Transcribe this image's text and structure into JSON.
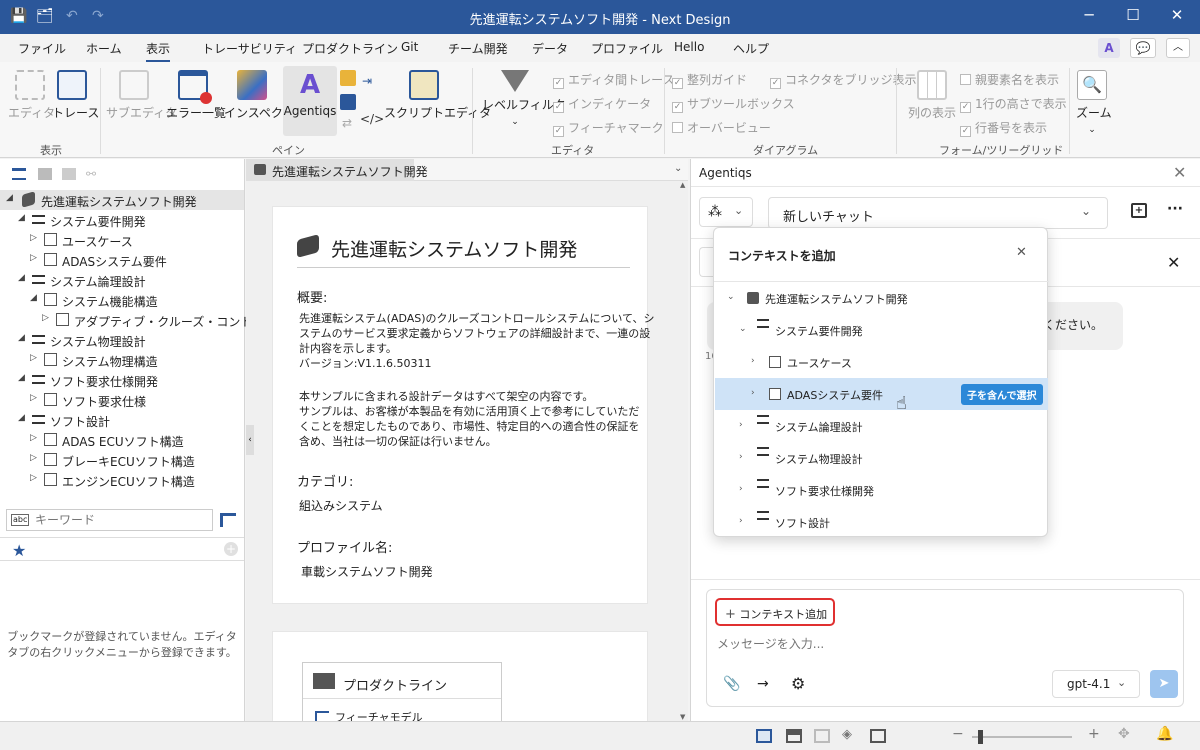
{
  "window": {
    "title": "先進運転システムソフト開発 - Next Design"
  },
  "menu": [
    "ファイル",
    "ホーム",
    "表示",
    "トレーサビリティ",
    "プロダクトライン",
    "Git",
    "チーム開発",
    "データ",
    "プロファイル",
    "Hello",
    "ヘルプ"
  ],
  "menu_active": "表示",
  "ribbon": {
    "btn_editor": "エディタ",
    "btn_trace": "トレース",
    "group_display": "表示",
    "btn_subeditor": "サブエディタ",
    "btn_errorlist": "エラー一覧",
    "btn_inspector": "インスペクタ",
    "btn_agentiqs": "Agentiqs",
    "btn_scripteditor": "スクリプトエディタ",
    "group_pane": "ペイン",
    "btn_levelfilter": "レベルフィルタ",
    "chk_editor_trace": "エディタ間トレース",
    "chk_indicator": "インディケータ",
    "chk_feature_mark": "フィーチャマーク",
    "group_editor": "エディタ",
    "chk_align_guide": "整列ガイド",
    "chk_subtoolbox": "サブツールボックス",
    "chk_overview": "オーバービュー",
    "chk_connector_bridge": "コネクタをブリッジ表示",
    "group_diagram": "ダイアグラム",
    "btn_column_display": "列の表示",
    "chk_parent_name": "親要素名を表示",
    "chk_one_line": "1行の高さで表示",
    "chk_row_number": "行番号を表示",
    "group_form": "フォーム/ツリーグリッド",
    "btn_zoom": "ズーム"
  },
  "tree": {
    "root": "先進運転システムソフト開発",
    "items": [
      {
        "label": "システム要件開発",
        "level": 1
      },
      {
        "label": "ユースケース",
        "level": 2
      },
      {
        "label": "ADASシステム要件",
        "level": 2
      },
      {
        "label": "システム論理設計",
        "level": 1
      },
      {
        "label": "システム機能構造",
        "level": 2
      },
      {
        "label": "アダプティブ・クルーズ・コントロール",
        "level": 3
      },
      {
        "label": "システム物理設計",
        "level": 1
      },
      {
        "label": "システム物理構造",
        "level": 2
      },
      {
        "label": "ソフト要求仕様開発",
        "level": 1
      },
      {
        "label": "ソフト要求仕様",
        "level": 2
      },
      {
        "label": "ソフト設計",
        "level": 1
      },
      {
        "label": "ADAS ECUソフト構造",
        "level": 2
      },
      {
        "label": "ブレーキECUソフト構造",
        "level": 2
      },
      {
        "label": "エンジンECUソフト構造",
        "level": 2
      }
    ]
  },
  "search": {
    "placeholder": "キーワード"
  },
  "bookmark": {
    "empty_text_1": "ブックマークが登録されていません。エディタ",
    "empty_text_2": "タブの右クリックメニューから登録できます。"
  },
  "doc": {
    "tab": "先進運転システムソフト開発",
    "title": "先進運転システムソフト開発",
    "overview_heading": "概要:",
    "overview_lines": [
      "先進運転システム(ADAS)のクルーズコントロールシステムについて、シ",
      "ステムのサービス要求定義からソフトウェアの詳細設計まで、一連の設",
      "計内容を示します。",
      "バージョン:V1.1.6.50311"
    ],
    "notice_lines": [
      "本サンプルに含まれる設計データはすべて架空の内容です。",
      "サンプルは、お客様が本製品を有効に活用頂く上で参考にしていただ",
      "くことを想定したものであり、市場性、特定目的への適合性の保証を",
      "含め、当社は一切の保証は行いません。"
    ],
    "category_heading": "カテゴリ:",
    "category_value": "組込みシステム",
    "profile_heading": "プロファイル名:",
    "profile_value": "車載システムソフト開発",
    "productline_title": "プロダクトライン",
    "feature_model": "フィーチャモデル"
  },
  "agent": {
    "panel_title": "Agentiqs",
    "chat_select": "新しいチャット",
    "bubble_tail": "ください。",
    "timestamp_fragment": "16",
    "popup_title": "コンテキストを追加",
    "popup_root": "先進運転システムソフト開発",
    "popup_items": [
      {
        "label": "システム要件開発",
        "level": 1,
        "expanded": true
      },
      {
        "label": "ユースケース",
        "level": 2
      },
      {
        "label": "ADASシステム要件",
        "level": 2,
        "highlight": true
      },
      {
        "label": "システム論理設計",
        "level": 1
      },
      {
        "label": "システム物理設計",
        "level": 1
      },
      {
        "label": "ソフト要求仕様開発",
        "level": 1
      },
      {
        "label": "ソフト設計",
        "level": 1
      }
    ],
    "select_with_children": "子を含んで選択",
    "add_context": "コンテキスト追加",
    "message_placeholder": "メッセージを入力...",
    "model": "gpt-4.1"
  },
  "colors": {
    "titlebar": "#2b579a",
    "accent": "#2b88d8",
    "highlight_red": "#e03030",
    "selection": "#cfe3f7"
  }
}
